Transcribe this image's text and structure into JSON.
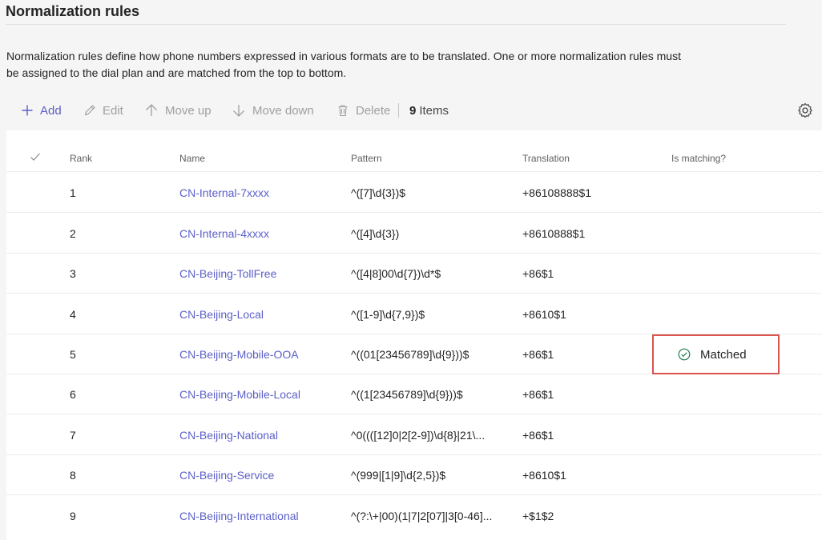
{
  "page": {
    "title": "Normalization rules",
    "description": "Normalization rules define how phone numbers expressed in various formats are to be translated. One or more normalization rules must be assigned to the dial plan and are matched from the top to bottom."
  },
  "toolbar": {
    "add": "Add",
    "edit": "Edit",
    "move_up": "Move up",
    "move_down": "Move down",
    "delete": "Delete",
    "count": "9",
    "count_label": "Items"
  },
  "table": {
    "headers": {
      "rank": "Rank",
      "name": "Name",
      "pattern": "Pattern",
      "translation": "Translation",
      "matching": "Is matching?"
    },
    "rows": [
      {
        "rank": "1",
        "name": "CN-Internal-7xxxx",
        "pattern": "^([7]\\d{3})$",
        "translation": "+86108888$1"
      },
      {
        "rank": "2",
        "name": "CN-Internal-4xxxx",
        "pattern": "^([4]\\d{3})",
        "translation": "+8610888$1"
      },
      {
        "rank": "3",
        "name": "CN-Beijing-TollFree",
        "pattern": "^([4|8]00\\d{7})\\d*$",
        "translation": "+86$1"
      },
      {
        "rank": "4",
        "name": "CN-Beijing-Local",
        "pattern": "^([1-9]\\d{7,9})$",
        "translation": "+8610$1"
      },
      {
        "rank": "5",
        "name": "CN-Beijing-Mobile-OOA",
        "pattern": "^((01[23456789]\\d{9}))$",
        "translation": "+86$1"
      },
      {
        "rank": "6",
        "name": "CN-Beijing-Mobile-Local",
        "pattern": "^((1[23456789]\\d{9}))$",
        "translation": "+86$1"
      },
      {
        "rank": "7",
        "name": "CN-Beijing-National",
        "pattern": "^0((([12]0|2[2-9])\\d{8}|21\\...",
        "translation": "+86$1"
      },
      {
        "rank": "8",
        "name": "CN-Beijing-Service",
        "pattern": "^(999|[1|9]\\d{2,5})$",
        "translation": "+8610$1"
      },
      {
        "rank": "9",
        "name": "CN-Beijing-International",
        "pattern": "^(?:\\+|00)(1|7|2[07]|3[0-46]...",
        "translation": "+$1$2"
      }
    ],
    "match": {
      "row_rank": "5",
      "label": "Matched",
      "icon": "check-circle-icon",
      "highlight_color": "#d9534f"
    }
  },
  "colors": {
    "accent": "#5b5fc7",
    "disabled": "#a19f9d"
  }
}
